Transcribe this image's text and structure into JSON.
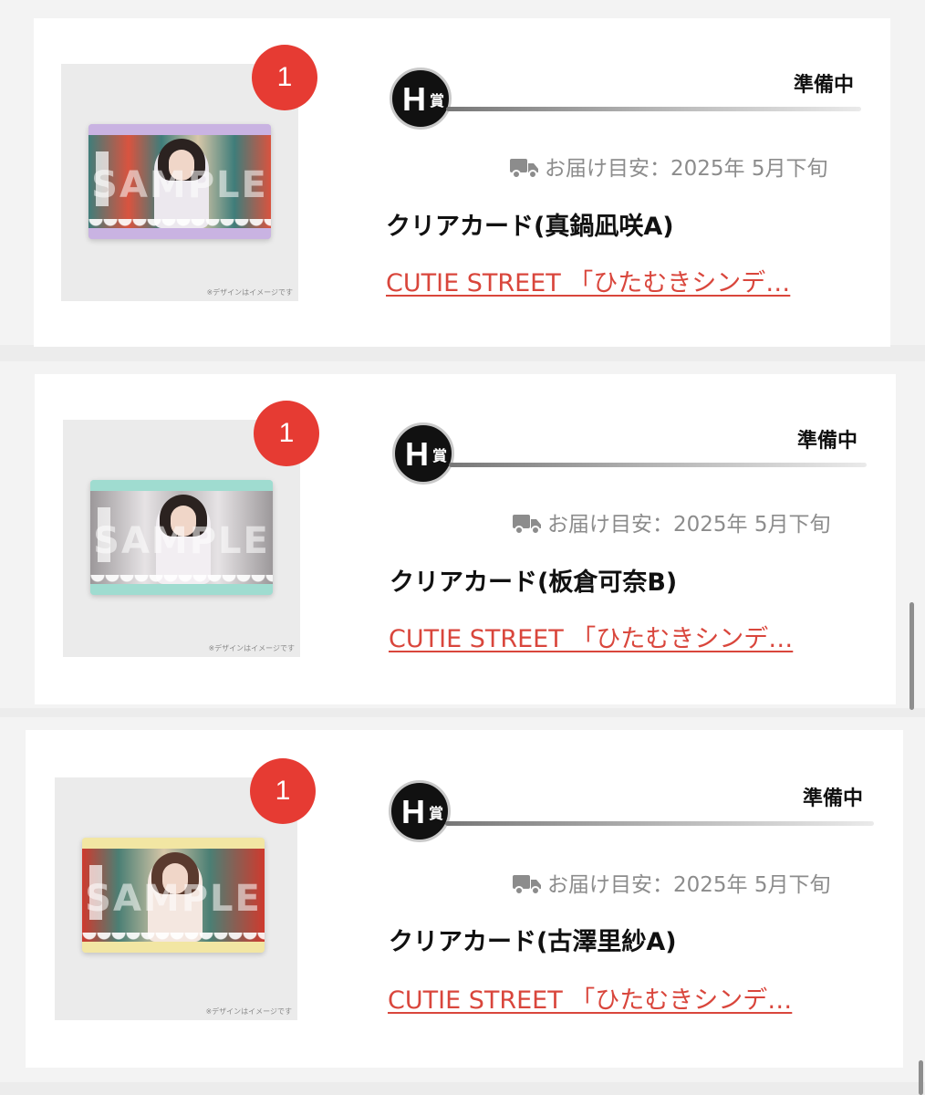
{
  "items": [
    {
      "quantity": "1",
      "prize_letter": "H",
      "prize_suffix": "賞",
      "status": "準備中",
      "delivery_icon": "truck-icon",
      "delivery_text": "お届け目安：2025年 5月下旬",
      "product_name": "クリアカード(真鍋凪咲A)",
      "product_link": "CUTIE STREET 「ひたむきシンデ…",
      "thumb_note": "※デザインはイメージです",
      "sample_text": "SAMPLE",
      "card_colors": {
        "band": "#c9b3e2",
        "scene": "#3f7d7a",
        "accent": "#d9533f",
        "dress": "#ece8ee"
      }
    },
    {
      "quantity": "1",
      "prize_letter": "H",
      "prize_suffix": "賞",
      "status": "準備中",
      "delivery_icon": "truck-icon",
      "delivery_text": "お届け目安：2025年 5月下旬",
      "product_name": "クリアカード(板倉可奈B)",
      "product_link": "CUTIE STREET 「ひたむきシンデ…",
      "thumb_note": "※デザインはイメージです",
      "sample_text": "SAMPLE",
      "card_colors": {
        "band": "#9fdcd0",
        "scene": "#b8b4b6",
        "accent": "#d8d4d8",
        "dress": "#f2eef2"
      }
    },
    {
      "quantity": "1",
      "prize_letter": "H",
      "prize_suffix": "賞",
      "status": "準備中",
      "delivery_icon": "truck-icon",
      "delivery_text": "お届け目安：2025年 5月下旬",
      "product_name": "クリアカード(古澤里紗A)",
      "product_link": "CUTIE STREET 「ひたむきシンデ…",
      "thumb_note": "※デザインはイメージです",
      "sample_text": "SAMPLE",
      "card_colors": {
        "band": "#f2e6a3",
        "scene": "#4b7f74",
        "accent": "#cf3a2e",
        "dress": "#f4e7e0"
      }
    }
  ],
  "colors": {
    "badge": "#e63b33",
    "link": "#d9463c",
    "status_text": "#111111",
    "muted_text": "#8c8c8c"
  }
}
